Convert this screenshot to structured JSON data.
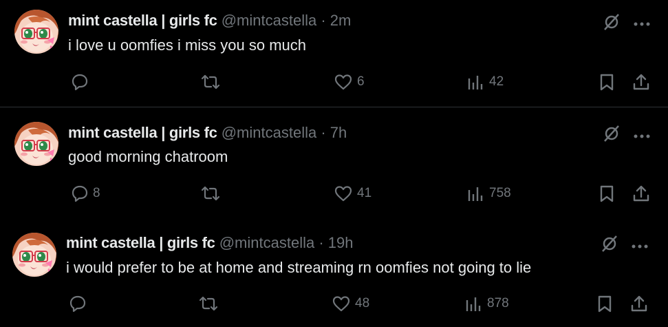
{
  "tweets": [
    {
      "name": "mint castella | girls fc",
      "handle": "@mintcastella",
      "separator": "·",
      "time": "2m",
      "text": "i love u oomfies i miss you so much",
      "replies": "",
      "reposts": "",
      "likes": "6",
      "views": "42"
    },
    {
      "name": "mint castella | girls fc",
      "handle": "@mintcastella",
      "separator": "·",
      "time": "7h",
      "text": "good morning chatroom",
      "replies": "8",
      "reposts": "",
      "likes": "41",
      "views": "758"
    },
    {
      "name": "mint castella | girls fc",
      "handle": "@mintcastella",
      "separator": "·",
      "time": "19h",
      "text": "i would prefer to be at home and streaming rn oomfies not going to lie",
      "replies": "",
      "reposts": "",
      "likes": "48",
      "views": "878"
    }
  ],
  "icons": {
    "reply": "reply-icon",
    "repost": "repost-icon",
    "like": "heart-icon",
    "views": "views-icon",
    "bookmark": "bookmark-icon",
    "share": "share-icon",
    "grok": "grok-icon",
    "more": "more-icon"
  },
  "colors": {
    "background": "#000000",
    "text": "#e7e9ea",
    "muted": "#71767b",
    "divider": "#2f3336"
  }
}
